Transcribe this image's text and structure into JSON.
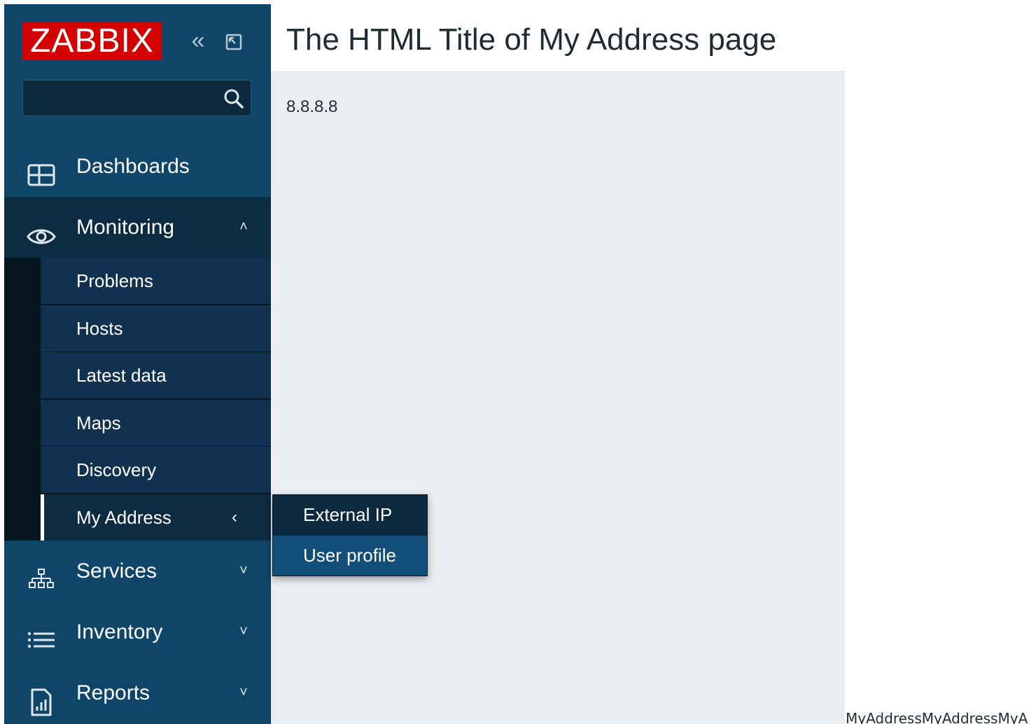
{
  "app": {
    "logo_text": "ZABBIX",
    "brand_color": "#d40000",
    "collapse_icon": "double-chevron-left-icon",
    "kiosk_icon": "kiosk-mode-icon"
  },
  "search": {
    "value": "",
    "placeholder": "",
    "icon": "search-icon"
  },
  "nav": {
    "dashboards": {
      "label": "Dashboards",
      "icon": "dashboard-grid-icon"
    },
    "monitoring": {
      "label": "Monitoring",
      "icon": "eye-icon",
      "chevron": "˄"
    },
    "monitoring_items": [
      {
        "label": "Problems"
      },
      {
        "label": "Hosts"
      },
      {
        "label": "Latest data"
      },
      {
        "label": "Maps"
      },
      {
        "label": "Discovery"
      },
      {
        "label": "My Address",
        "chevron": "‹"
      }
    ],
    "services": {
      "label": "Services",
      "icon": "services-tree-icon",
      "chevron": "˅"
    },
    "inventory": {
      "label": "Inventory",
      "icon": "list-icon",
      "chevron": "˅"
    },
    "reports": {
      "label": "Reports",
      "icon": "report-chart-icon",
      "chevron": "˅"
    }
  },
  "flyout": {
    "items": [
      {
        "label": "External IP"
      },
      {
        "label": "User profile"
      }
    ]
  },
  "page": {
    "title": "The HTML Title of My Address page",
    "ip": "8.8.8.8",
    "footer_text": "MyAddressMyAddressMyA"
  },
  "colors": {
    "sidebar": "#0f4568",
    "sidebar_active": "#0b2c42",
    "content_bg": "#ebeef0"
  }
}
